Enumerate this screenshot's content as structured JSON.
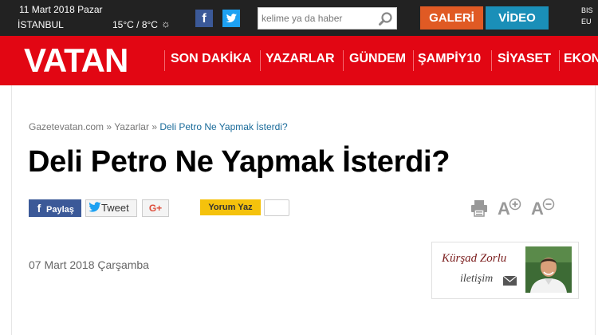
{
  "topbar": {
    "date": "11 Mart 2018 Pazar",
    "city": "İSTANBUL",
    "temperature": "15°C / 8°C",
    "search_placeholder": "kelime ya da haber",
    "galeri_label": "GALERİ",
    "video_label": "VİDEO",
    "right_text_line1": "BIS",
    "right_text_line2": "EU"
  },
  "nav": {
    "logo": "VATAN",
    "items": [
      "SON DAKİKA",
      "YAZARLAR",
      "GÜNDEM",
      "ŞAMPİY10",
      "SİYASET",
      "EKON"
    ]
  },
  "breadcrumb": {
    "home": "Gazetevatan.com",
    "sep1": " » ",
    "section": "Yazarlar",
    "sep2": " » ",
    "current": "Deli Petro Ne Yapmak İsterdi?"
  },
  "article": {
    "title": "Deli Petro Ne Yapmak İsterdi?",
    "date": "07 Mart 2018 Çarşamba"
  },
  "share": {
    "facebook_label": "Paylaş",
    "twitter_label": "Tweet",
    "gplus_label": "G+",
    "comment_label": "Yorum Yaz"
  },
  "tools": {
    "font_plus": "A",
    "font_minus": "A"
  },
  "author": {
    "name": "Kürşad Zorlu",
    "contact_label": "iletişim"
  },
  "colors": {
    "nav_red": "#e20613",
    "topbar_dark": "#222222",
    "galeri_orange": "#e05a24",
    "video_blue": "#1a8fb8",
    "comment_yellow": "#f5c20c"
  }
}
